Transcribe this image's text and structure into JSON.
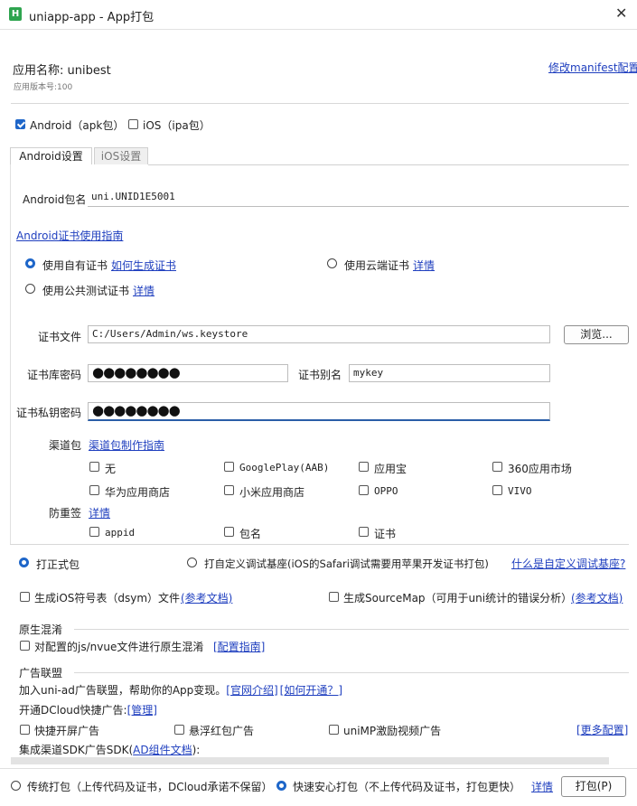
{
  "window": {
    "title": "uniapp-app - App打包",
    "logo_letter": "H"
  },
  "app": {
    "name_label": "应用名称:",
    "name_value": "unibest",
    "version_label": "应用版本号:",
    "version_value": "100",
    "modify_link": "修改manifest配置"
  },
  "platforms": {
    "android_label": "Android（apk包）",
    "ios_label": "iOS（ipa包）"
  },
  "tabs": {
    "android": "Android设置",
    "ios": "iOS设置"
  },
  "android": {
    "package_label": "Android包名",
    "package_value": "uni.UNID1E5001",
    "cert_guide_link": "Android证书使用指南",
    "cert_own_label": "使用自有证书",
    "cert_own_link": "如何生成证书",
    "cert_cloud_label": "使用云端证书",
    "cert_cloud_link": "详情",
    "cert_public_label": "使用公共测试证书",
    "cert_public_link": "详情",
    "cert_file_label": "证书文件",
    "cert_file_value": "C:/Users/Admin/ws.keystore",
    "browse_button": "浏览...",
    "keystore_pwd_label": "证书库密码",
    "keystore_pwd_value": "●●●●●●●●",
    "alias_label": "证书别名",
    "alias_value": "mykey",
    "key_pwd_label": "证书私钥密码",
    "key_pwd_value": "●●●●●●●●",
    "channel_label": "渠道包",
    "channel_link": "渠道包制作指南",
    "channels": [
      "无",
      "GooglePlay(AAB)",
      "应用宝",
      "360应用市场",
      "华为应用商店",
      "小米应用商店",
      "OPPO",
      "VIVO"
    ],
    "anti_label": "防重签",
    "anti_link": "详情",
    "anti_options": [
      "appid",
      "包名",
      "证书"
    ]
  },
  "build": {
    "formal_label": "打正式包",
    "custom_label": "打自定义调试基座(iOS的Safari调试需要用苹果开发证书打包)",
    "custom_link": "什么是自定义调试基座?",
    "dsym_label": "生成iOS符号表（dsym）文件",
    "dsym_link": "(参考文档)",
    "sourcemap_label": "生成SourceMap（可用于uni统计的错误分析）",
    "sourcemap_link": "(参考文档)"
  },
  "obfuscation": {
    "title": "原生混淆",
    "check_label": "对配置的js/nvue文件进行原生混淆",
    "guide_link": "[配置指南]"
  },
  "ads": {
    "title": "广告联盟",
    "intro": "加入uni-ad广告联盟，帮助你的App变现。",
    "intro_link1": "[官网介绍]",
    "intro_link2": "[如何开通？]",
    "dcloud_label": "开通DCloud快捷广告:",
    "manage_link": "[管理]",
    "splash_label": "快捷开屏广告",
    "float_label": "悬浮红包广告",
    "video_label": "uniMP激励视频广告",
    "more_link": "[更多配置]",
    "sdk_label_prefix": "集成渠道SDK广告SDK(",
    "sdk_link": "AD组件文档",
    "sdk_label_suffix": "):"
  },
  "footer": {
    "traditional_label": "传统打包（上传代码及证书，DCloud承诺不保留）",
    "fast_label": "快速安心打包（不上传代码及证书，打包更快）",
    "detail_link": "详情",
    "pack_button": "打包(P)"
  },
  "colors": {
    "accent": "#1e66c9",
    "link": "#1f3fbf"
  }
}
